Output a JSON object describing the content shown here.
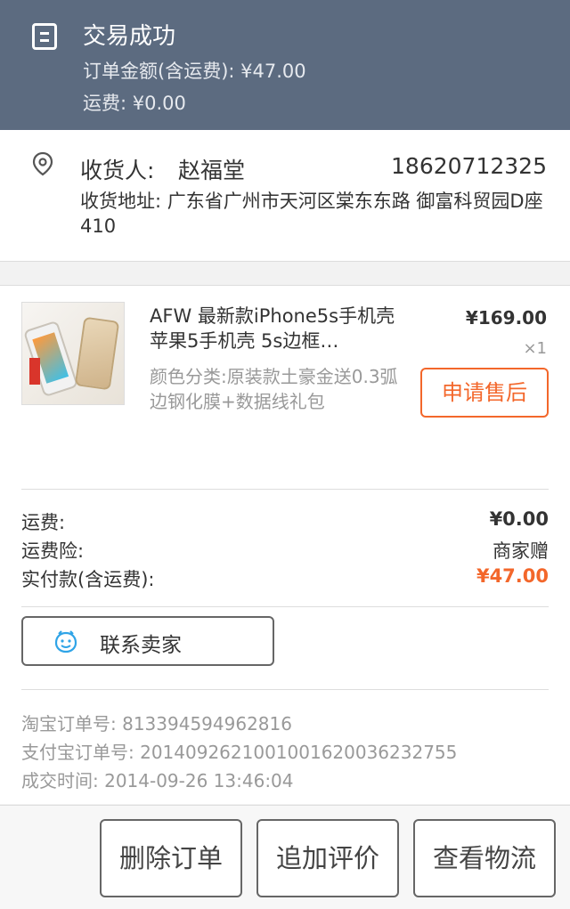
{
  "status": {
    "title": "交易成功",
    "order_amount": "订单金额(含运费): ¥47.00",
    "shipping_line": "运费: ¥0.00"
  },
  "address": {
    "receiver_label": "收货人:",
    "receiver_name": "赵福堂",
    "phone": "18620712325",
    "address_text": "收货地址: 广东省广州市天河区棠东东路 御富科贸园D座410"
  },
  "product": {
    "title": "AFW 最新款iPhone5s手机壳 苹果5手机壳 5s边框…",
    "sku": "颜色分类:原装款土豪金送0.3弧边钢化膜+数据线礼包",
    "price": "¥169.00",
    "quantity": "×1",
    "after_sale_label": "申请售后"
  },
  "fees": {
    "shipping_key": "运费:",
    "shipping_value": "¥0.00",
    "insurance_key": "运费险:",
    "insurance_value": "商家赠",
    "paid_key": "实付款(含运费):",
    "paid_value": "¥47.00"
  },
  "contact": {
    "label": "联系卖家"
  },
  "meta": {
    "taobao_order": "淘宝订单号: 813394594962816",
    "alipay_order": "支付宝订单号: 2014092621001001620036232755",
    "deal_time": "成交时间: 2014-09-26 13:46:04"
  },
  "actions": {
    "delete_label": "删除订单",
    "review_label": "追加评价",
    "logistics_label": "查看物流"
  },
  "colors": {
    "header_bg": "#5c6b80",
    "accent": "#f3672b"
  },
  "icons": {
    "status": "order-receipt-icon",
    "location": "location-pin-icon",
    "chat": "wangwang-chat-icon"
  }
}
